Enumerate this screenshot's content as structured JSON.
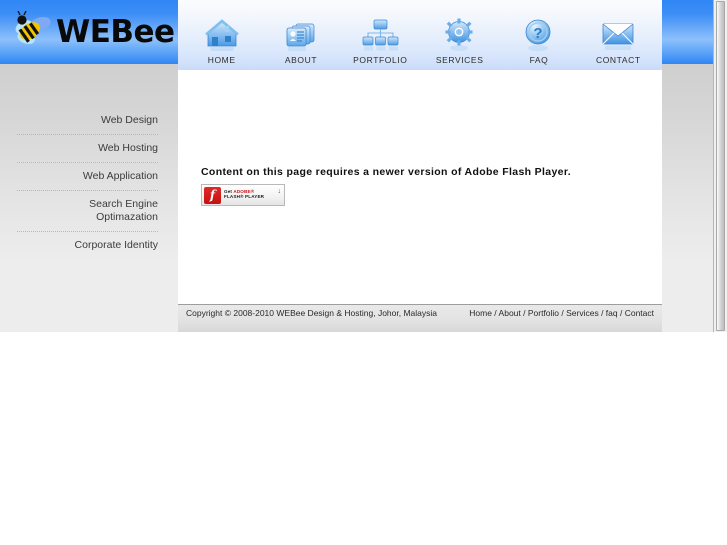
{
  "site": {
    "logo_text": "WEBee",
    "logo_icon": "bee-mascot-icon"
  },
  "nav": {
    "items": [
      {
        "label": "HOME",
        "icon": "house-icon"
      },
      {
        "label": "ABOUT",
        "icon": "id-cards-icon"
      },
      {
        "label": "PORTFOLIO",
        "icon": "sitemap-icon"
      },
      {
        "label": "SERVICES",
        "icon": "gear-icon"
      },
      {
        "label": "FAQ",
        "icon": "question-mark-icon"
      },
      {
        "label": "CONTACT",
        "icon": "envelope-icon"
      }
    ]
  },
  "sidebar": {
    "items": [
      {
        "label": "Web Design"
      },
      {
        "label": "Web Hosting"
      },
      {
        "label": "Web Application"
      },
      {
        "label": "Search Engine",
        "label2": "Optimazation"
      },
      {
        "label": "Corporate Identity"
      }
    ]
  },
  "main": {
    "flash_message": "Content on this page requires a newer version of Adobe Flash Player.",
    "get_flash_badge": {
      "glyph": "f",
      "line1_prefix": "Get ",
      "line1_brand": "ADOBE®",
      "line2": "FLASH® PLAYER",
      "arrow": "↓"
    }
  },
  "footer": {
    "copyright": "Copyright © 2008-2010 WEBee Design & Hosting, Johor, Malaysia",
    "links": "Home / About / Portfolio / Services / faq / Contact"
  },
  "colors": {
    "brand_blue": "#2f86f5",
    "nav_bg": "#dbe8fc",
    "page_bg": "#ededed",
    "flash_red": "#c41113"
  }
}
